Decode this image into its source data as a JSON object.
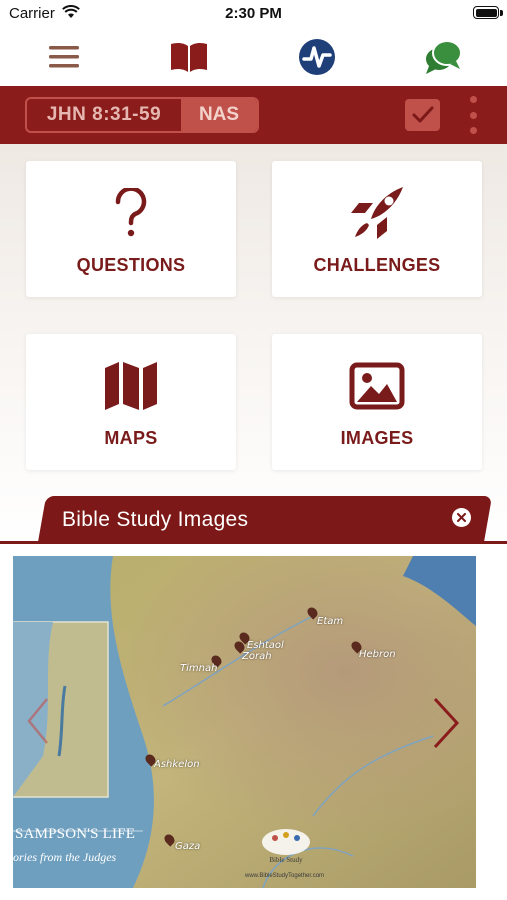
{
  "status": {
    "carrier": "Carrier",
    "time": "2:30 PM"
  },
  "nav": {
    "icons": [
      "menu-icon",
      "book-icon",
      "lightning-logo-icon",
      "chat-icon"
    ]
  },
  "reference": {
    "passage": "JHN 8:31-59",
    "version": "NAS"
  },
  "cards": [
    {
      "label": "QUESTIONS",
      "icon": "question-mark-icon"
    },
    {
      "label": "CHALLENGES",
      "icon": "rocket-icon"
    },
    {
      "label": "MAPS",
      "icon": "map-icon"
    },
    {
      "label": "IMAGES",
      "icon": "image-icon"
    }
  ],
  "images_panel": {
    "title": "Bible Study Images",
    "map": {
      "places": [
        "Etam",
        "Eshtaol",
        "Zorah",
        "Timnah",
        "Hebron",
        "Ashkelon",
        "Gaza"
      ],
      "caption_title": "SAMPSON'S LIFE",
      "caption_sub": "ories from the Judges",
      "logo_text": "Bible Study",
      "credit": "www.BibleStudyTogether.com"
    }
  },
  "colors": {
    "brand": "#7c1818",
    "accent": "#c0504a",
    "nav_blue": "#1f3f78",
    "nav_green": "#2e7d32"
  }
}
